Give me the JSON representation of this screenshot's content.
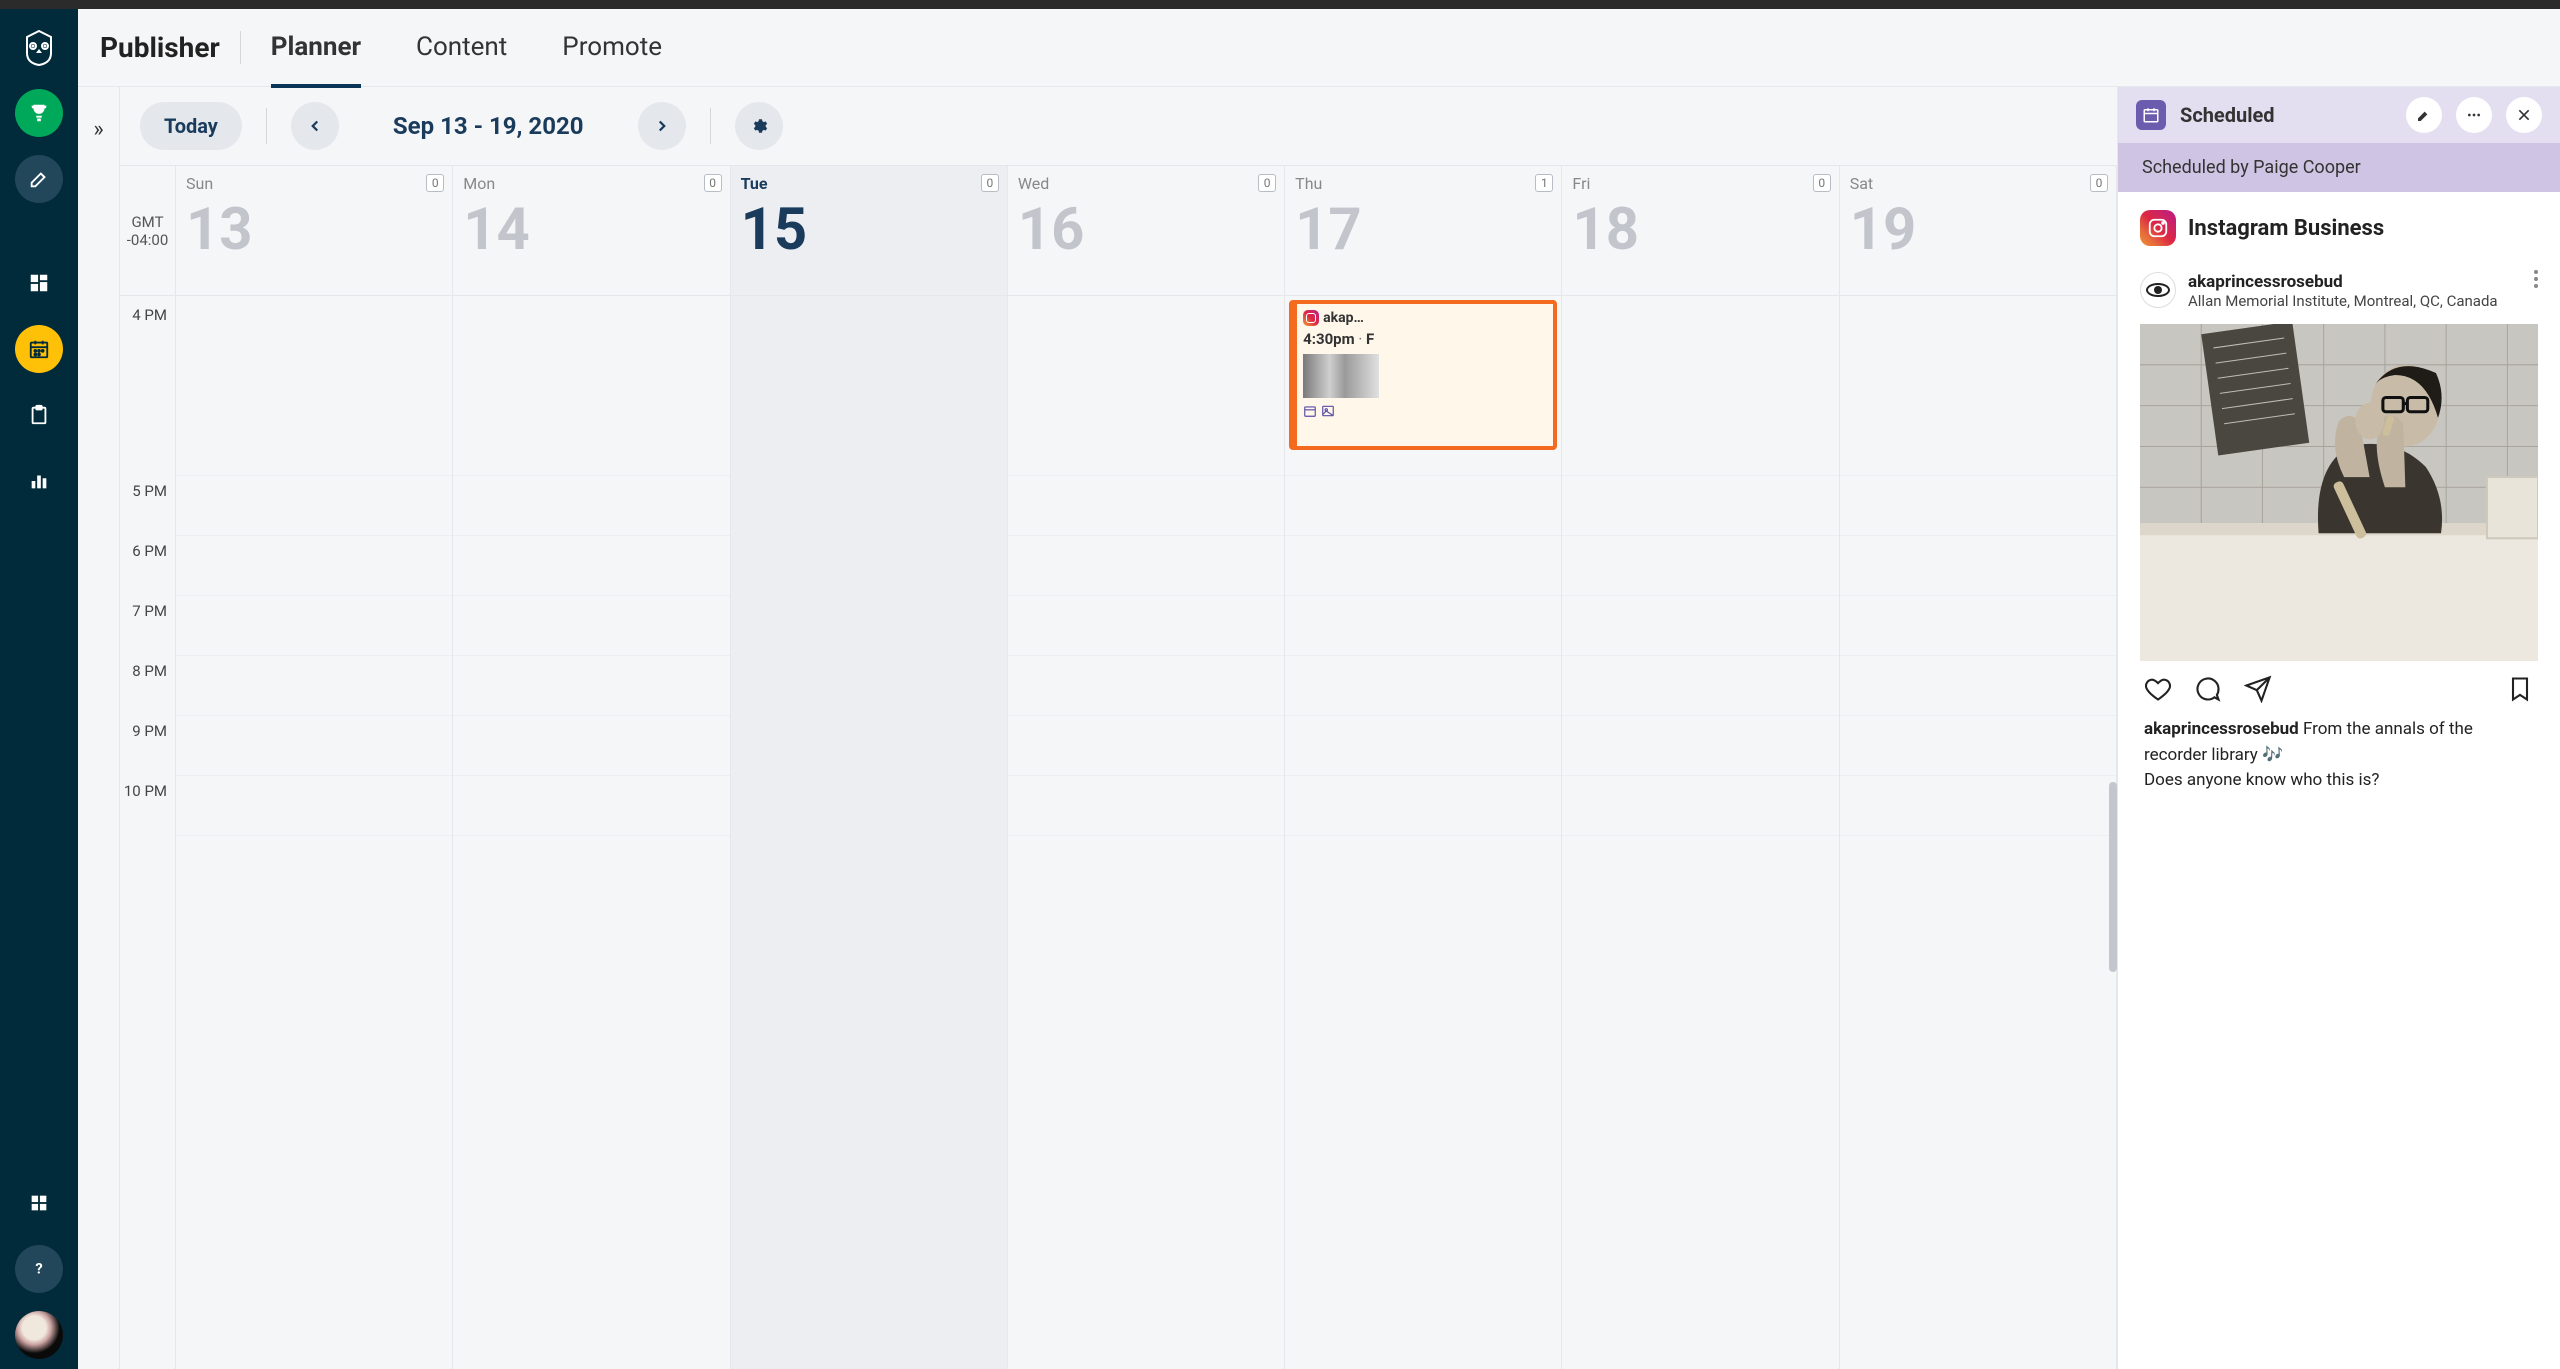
{
  "app_title": "Publisher",
  "tabs": {
    "t0": "Planner",
    "t1": "Content",
    "t2": "Promote"
  },
  "toolbar": {
    "today": "Today",
    "range": "Sep 13 - 19, 2020"
  },
  "tz": {
    "label": "GMT",
    "offset": "-04:00"
  },
  "days": [
    {
      "name": "Sun",
      "num": "13",
      "count": "0"
    },
    {
      "name": "Mon",
      "num": "14",
      "count": "0"
    },
    {
      "name": "Tue",
      "num": "15",
      "count": "0"
    },
    {
      "name": "Wed",
      "num": "16",
      "count": "0"
    },
    {
      "name": "Thu",
      "num": "17",
      "count": "1"
    },
    {
      "name": "Fri",
      "num": "18",
      "count": "0"
    },
    {
      "name": "Sat",
      "num": "19",
      "count": "0"
    }
  ],
  "hours": {
    "h0": "4 PM",
    "h1": "5 PM",
    "h2": "6 PM",
    "h3": "7 PM",
    "h4": "8 PM",
    "h5": "9 PM",
    "h6": "10 PM"
  },
  "event": {
    "account": "akap…",
    "time": "4:30pm",
    "sep": " · ",
    "tail": "F"
  },
  "panel": {
    "status": "Scheduled",
    "byline": "Scheduled by Paige Cooper",
    "network": "Instagram Business",
    "username": "akaprincessrosebud",
    "location": "Allan Memorial Institute, Montreal, QC, Canada",
    "caption_user": "akaprincessrosebud",
    "caption_1": "  From the annals of the recorder library 🎶",
    "caption_2": "Does anyone know who this is?"
  }
}
